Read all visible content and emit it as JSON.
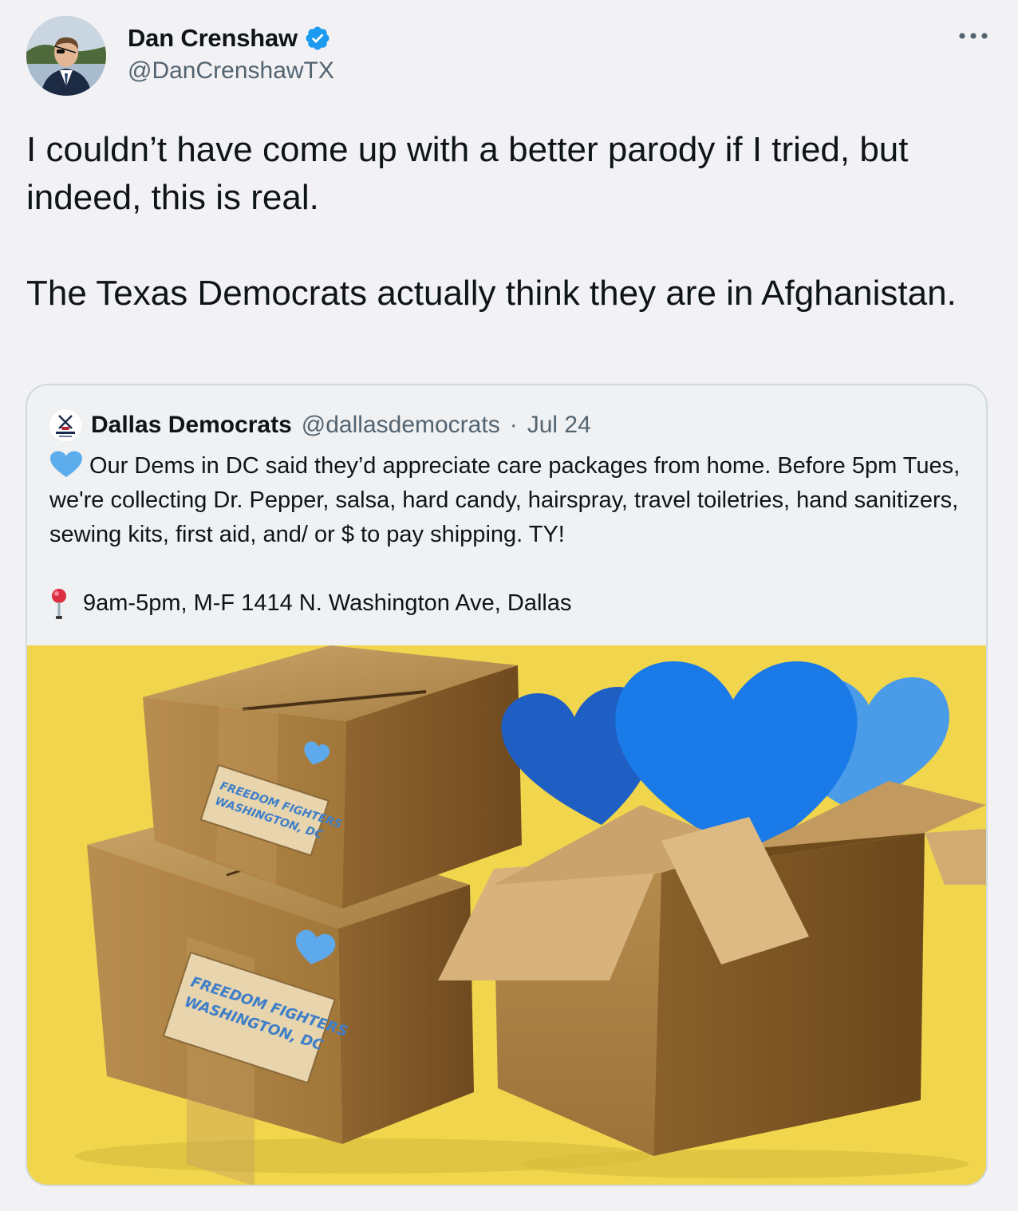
{
  "tweet": {
    "author": {
      "name": "Dan Crenshaw",
      "handle": "@DanCrenshawTX",
      "verified": true,
      "avatar_icon": "profile-photo"
    },
    "more_icon": "more-options-icon",
    "text_paragraphs": [
      "I couldn’t have come up with a better parody if I tried, but indeed, this is real.",
      "The Texas Democrats actually think they are in Afghanistan."
    ]
  },
  "quoted_tweet": {
    "author": {
      "name": "Dallas Democrats",
      "handle": "@dallasdemocrats",
      "avatar_icon": "dallas-democrats-logo"
    },
    "separator": "·",
    "date": "Jul 24",
    "body": {
      "heart_emoji": "blue-heart",
      "main": "Our Dems in DC said they’d appreciate care packages from home. Before 5pm Tues, we're collecting Dr. Pepper, salsa, hard candy, hairspray, travel toiletries, hand sanitizers, sewing kits, first aid, and/ or $ to pay shipping. TY!",
      "pin_emoji": "round-pushpin",
      "location": "9am-5pm, M-F 1414 N. Washington Ave, Dallas"
    },
    "image": {
      "box_label_line1": "FREEDOM FIGHTERS",
      "box_label_line2": "WASHINGTON, DC",
      "background_color": "#f1d54c"
    }
  },
  "colors": {
    "text_primary": "#0f1419",
    "text_secondary": "#536471",
    "verified_blue": "#1d9bf0",
    "card_border": "#cfd9de"
  }
}
